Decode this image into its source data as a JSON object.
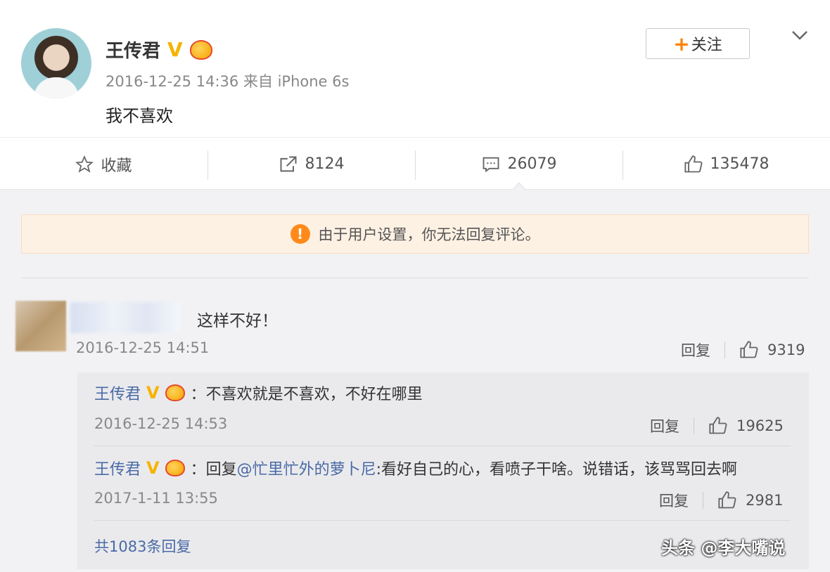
{
  "post": {
    "author": "王传君",
    "meta": "2016-12-25 14:36 来自 iPhone 6s",
    "content": "我不喜欢",
    "follow_label": "关注",
    "follow_plus": "+"
  },
  "actions": {
    "favorite": "收藏",
    "repost_count": "8124",
    "comment_count": "26079",
    "like_count": "135478"
  },
  "notice": "由于用户设置，你无法回复评论。",
  "comment": {
    "text": "这样不好！",
    "time": "2016-12-25 14:51",
    "reply_label": "回复",
    "likes": "9319"
  },
  "sub_replies": [
    {
      "name": "王传君",
      "text": "：不喜欢就是不喜欢，不好在哪里",
      "time": "2016-12-25 14:53",
      "reply_label": "回复",
      "likes": "19625"
    },
    {
      "name": "王传君",
      "prefix": "：回复",
      "mention": "@忙里忙外的萝卜尼",
      "text": ":看好自己的心，看喷子干啥。说错话，该骂骂回去啊",
      "time": "2017-1-11 13:55",
      "reply_label": "回复",
      "likes": "2981"
    }
  ],
  "total_replies": "共1083条回复",
  "watermark": "头条 @李大嘴说",
  "colors": {
    "accent": "#ff8200",
    "link": "#4a6aa5",
    "verified": "#f5b400"
  }
}
